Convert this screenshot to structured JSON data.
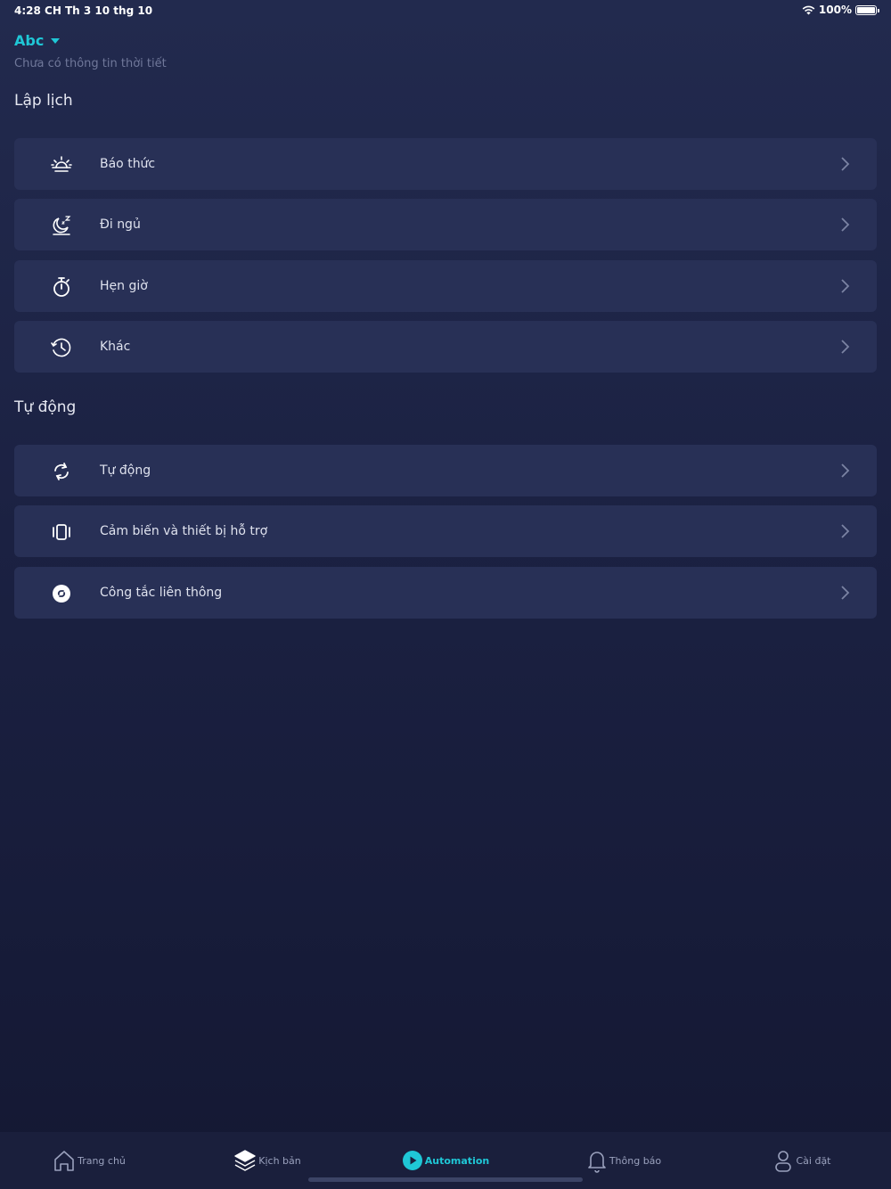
{
  "status_bar": {
    "time": "4:28 CH",
    "date": "Th 3 10 thg 10",
    "battery": "100%"
  },
  "header": {
    "home_name": "Abc",
    "weather": "Chưa có thông tin thời tiết"
  },
  "sections": {
    "schedule": {
      "title": "Lập lịch",
      "items": [
        {
          "label": "Báo thức",
          "icon": "sunrise-icon"
        },
        {
          "label": "Đi ngủ",
          "icon": "sleep-icon"
        },
        {
          "label": "Hẹn giờ",
          "icon": "timer-icon"
        },
        {
          "label": "Khác",
          "icon": "clock-icon"
        }
      ]
    },
    "auto": {
      "title": "Tự động",
      "items": [
        {
          "label": "Tự động",
          "icon": "sync-icon"
        },
        {
          "label": "Cảm biến và thiết bị hỗ trợ",
          "icon": "vibrate-icon"
        },
        {
          "label": "Công tắc liên thông",
          "icon": "link-icon"
        }
      ]
    }
  },
  "tabs": [
    {
      "label": "Trang chủ",
      "icon": "home-icon"
    },
    {
      "label": "Kịch bản",
      "icon": "layers-icon"
    },
    {
      "label": "Automation",
      "icon": "play-icon",
      "active": true
    },
    {
      "label": "Thông báo",
      "icon": "bell-icon"
    },
    {
      "label": "Cài đặt",
      "icon": "user-icon"
    }
  ],
  "colors": {
    "accent": "#1fc7d6",
    "card": "#283056",
    "background": "#1b2142"
  }
}
